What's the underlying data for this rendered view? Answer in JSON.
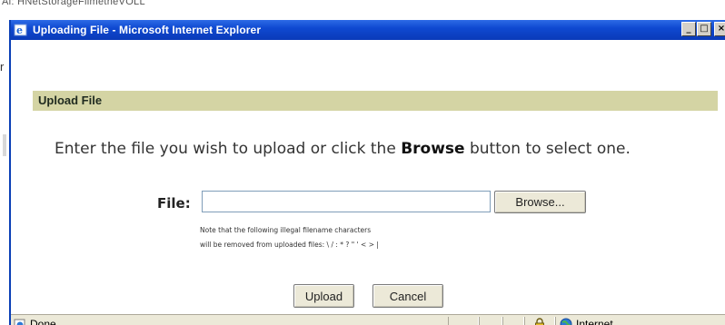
{
  "background": {
    "top_text": "Al:  HNetStorageFlimetheVOLL",
    "left_fragment": "r"
  },
  "window": {
    "title": "Uploading File - Microsoft Internet Explorer",
    "controls": {
      "minimize": "_",
      "maximize": "□",
      "close": "×"
    }
  },
  "form": {
    "section_title": "Upload File",
    "instruction_before": "Enter the file you wish to upload or click the ",
    "instruction_bold": "Browse",
    "instruction_after": " button to select one.",
    "file_label": "File:",
    "file_value": "",
    "browse_label": "Browse...",
    "note_line1": "Note that the following illegal filename characters",
    "note_line2": "will be removed from uploaded files: \\ / : * ? \" ' < > |",
    "upload_label": "Upload",
    "cancel_label": "Cancel"
  },
  "statusbar": {
    "status": "Done",
    "zone": "Internet",
    "icons": [
      "ie-page-icon",
      "lock-icon",
      "internet-globe-icon"
    ]
  },
  "colors": {
    "titlebar": "#0f49d1",
    "section_header": "#d4d4a4",
    "statusbar": "#ece9d8"
  }
}
